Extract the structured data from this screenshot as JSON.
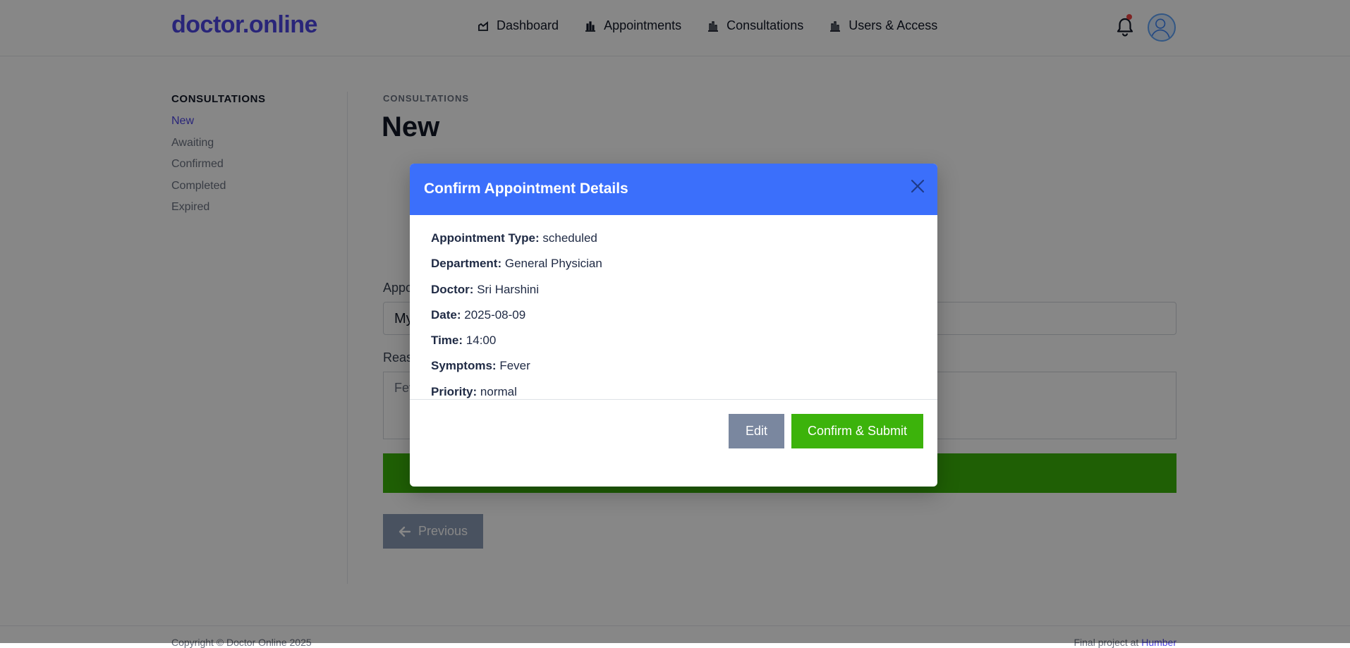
{
  "brand": {
    "logo": "doctor.online",
    "accent": "#4f46e5"
  },
  "nav": {
    "items": [
      {
        "label": "Dashboard",
        "icon": "dashboard-icon"
      },
      {
        "label": "Appointments",
        "icon": "chart-bar-icon"
      },
      {
        "label": "Consultations",
        "icon": "chart-bar-icon"
      },
      {
        "label": "Users & Access",
        "icon": "chart-bar-icon"
      }
    ],
    "notifications_icon": "bell-icon",
    "avatar_icon": "user-avatar-icon"
  },
  "sidebar": {
    "heading": "CONSULTATIONS",
    "items": [
      {
        "label": "New",
        "active": true
      },
      {
        "label": "Awaiting"
      },
      {
        "label": "Confirmed"
      },
      {
        "label": "Completed"
      },
      {
        "label": "Expired"
      }
    ]
  },
  "main": {
    "breadcrumb": "CONSULTATIONS",
    "title": "New",
    "appointment_label": "Appo",
    "appointment_value": "My",
    "reason_label": "Reas",
    "reason_value": "Fev",
    "previous_label": "Previous"
  },
  "modal": {
    "title": "Confirm Appointment Details",
    "header_color": "#3b6ffb",
    "details": [
      {
        "label": "Appointment Type:",
        "value": "scheduled"
      },
      {
        "label": "Department:",
        "value": "General Physician"
      },
      {
        "label": "Doctor:",
        "value": "Sri Harshini"
      },
      {
        "label": "Date:",
        "value": "2025-08-09"
      },
      {
        "label": "Time:",
        "value": "14:00"
      },
      {
        "label": "Symptoms:",
        "value": "Fever"
      },
      {
        "label": "Priority:",
        "value": "normal"
      }
    ],
    "edit_label": "Edit",
    "confirm_label": "Confirm & Submit",
    "confirm_color": "#3cb30b"
  },
  "footer": {
    "copyright": "Copyright © Doctor Online 2025",
    "right_text": "Final project at",
    "right_link": "Humber"
  }
}
